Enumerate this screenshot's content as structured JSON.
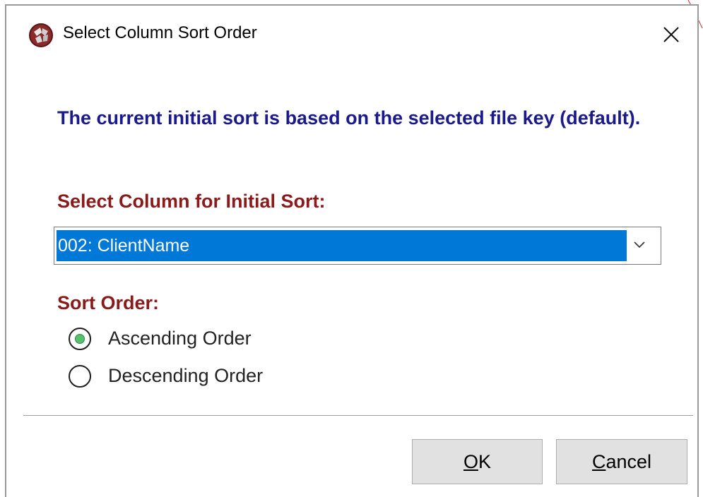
{
  "window": {
    "title": "Select Column Sort Order",
    "app_icon": "app-logo-icon",
    "close_icon": "close-icon"
  },
  "dialog": {
    "intro_text": "The current initial sort is based on the selected file key (default).",
    "sort_column_label": "Select Column for Initial Sort:",
    "sort_column_select": {
      "selected": "002: ClientName",
      "arrow_icon": "chevron-down-icon"
    },
    "sort_order_label": "Sort Order:",
    "sort_order_options": [
      {
        "label": "Ascending Order",
        "checked": true
      },
      {
        "label": "Descending Order",
        "checked": false
      }
    ]
  },
  "buttons": {
    "ok": {
      "mnemonic": "O",
      "rest": "K"
    },
    "cancel": {
      "mnemonic": "C",
      "rest": "ancel"
    }
  },
  "colors": {
    "intro_text": "#1a1a8c",
    "section_labels": "#8b1a1a",
    "selection_highlight": "#0078d7",
    "radio_selected": "#56c16b"
  }
}
